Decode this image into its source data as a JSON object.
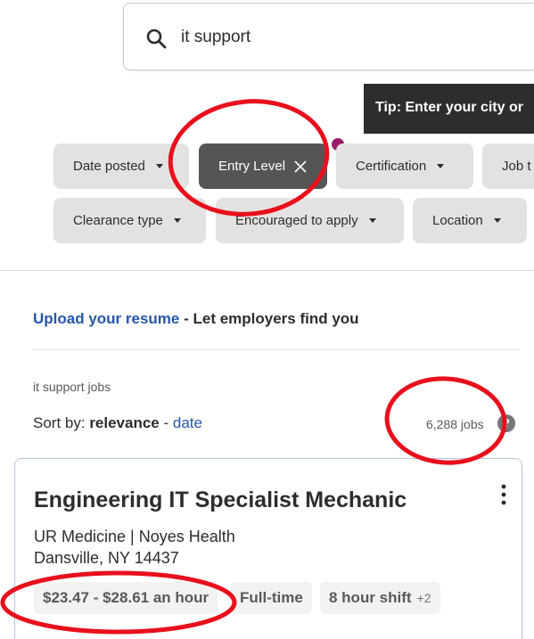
{
  "search": {
    "value": "it support"
  },
  "tip": {
    "text": "Tip: Enter your city or"
  },
  "filters": [
    {
      "label": "Date posted"
    },
    {
      "label": "Entry Level",
      "active": true
    },
    {
      "label": "Certification"
    },
    {
      "label": "Job t"
    },
    {
      "label": "Clearance type"
    },
    {
      "label": "Encouraged to apply"
    },
    {
      "label": "Location"
    }
  ],
  "upload": {
    "link": "Upload your resume",
    "rest": " - Let employers find you"
  },
  "results": {
    "label": "it support jobs",
    "sort_prefix": "Sort by: ",
    "sort_active": "relevance",
    "sort_sep": " - ",
    "sort_alt": "date",
    "count": "6,288 jobs",
    "help": "?"
  },
  "job": {
    "title": "Engineering IT Specialist Mechanic",
    "company": "UR Medicine | Noyes Health",
    "location": "Dansville, NY 14437",
    "tags": [
      "$23.47 - $28.61 an hour",
      "Full-time",
      "8 hour shift"
    ],
    "more": "+2"
  },
  "colors": {
    "annotation": "#e8101c",
    "link": "#2557a7",
    "dot": "#9c1c6b"
  }
}
